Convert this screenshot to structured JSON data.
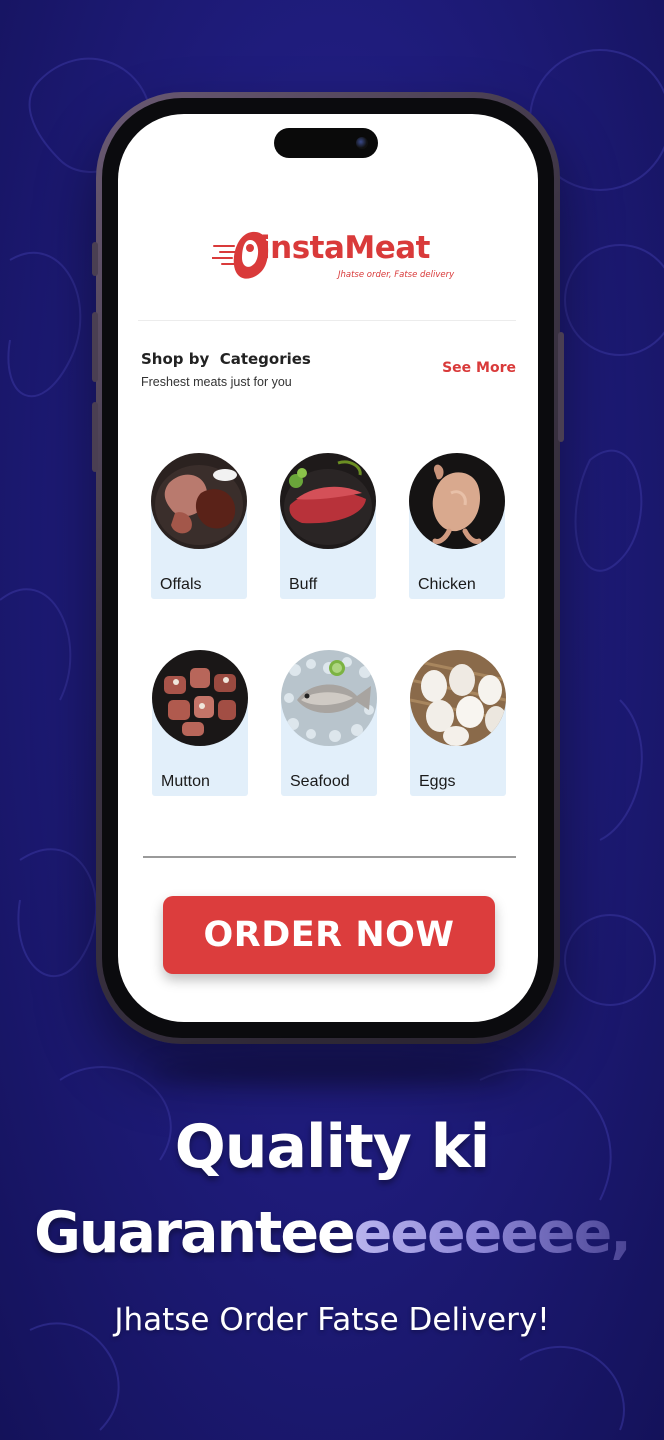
{
  "brand": {
    "name": "instaMeat",
    "tagline": "Jhatse order, Fatse delivery",
    "accent_color": "#d93a3a"
  },
  "section": {
    "title": "Shop by  Categories",
    "subtitle": "Freshest meats just for you",
    "see_more_label": "See More"
  },
  "categories": [
    {
      "label": "Offals",
      "icon": "offals-image"
    },
    {
      "label": "Buff",
      "icon": "buff-image"
    },
    {
      "label": "Chicken",
      "icon": "chicken-image"
    },
    {
      "label": "Mutton",
      "icon": "mutton-image"
    },
    {
      "label": "Seafood",
      "icon": "seafood-image"
    },
    {
      "label": "Eggs",
      "icon": "eggs-image"
    }
  ],
  "cta": {
    "order_label": "ORDER NOW"
  },
  "promo": {
    "line1": "Quality ki",
    "line2_main": "Guarantee",
    "line2_tail": "eeeeeee,",
    "tagline": "Jhatse Order Fatse Delivery!"
  },
  "colors": {
    "background": "#1f1c7c",
    "card_bg": "#e2effa",
    "button_bg": "#dc3d3d"
  }
}
